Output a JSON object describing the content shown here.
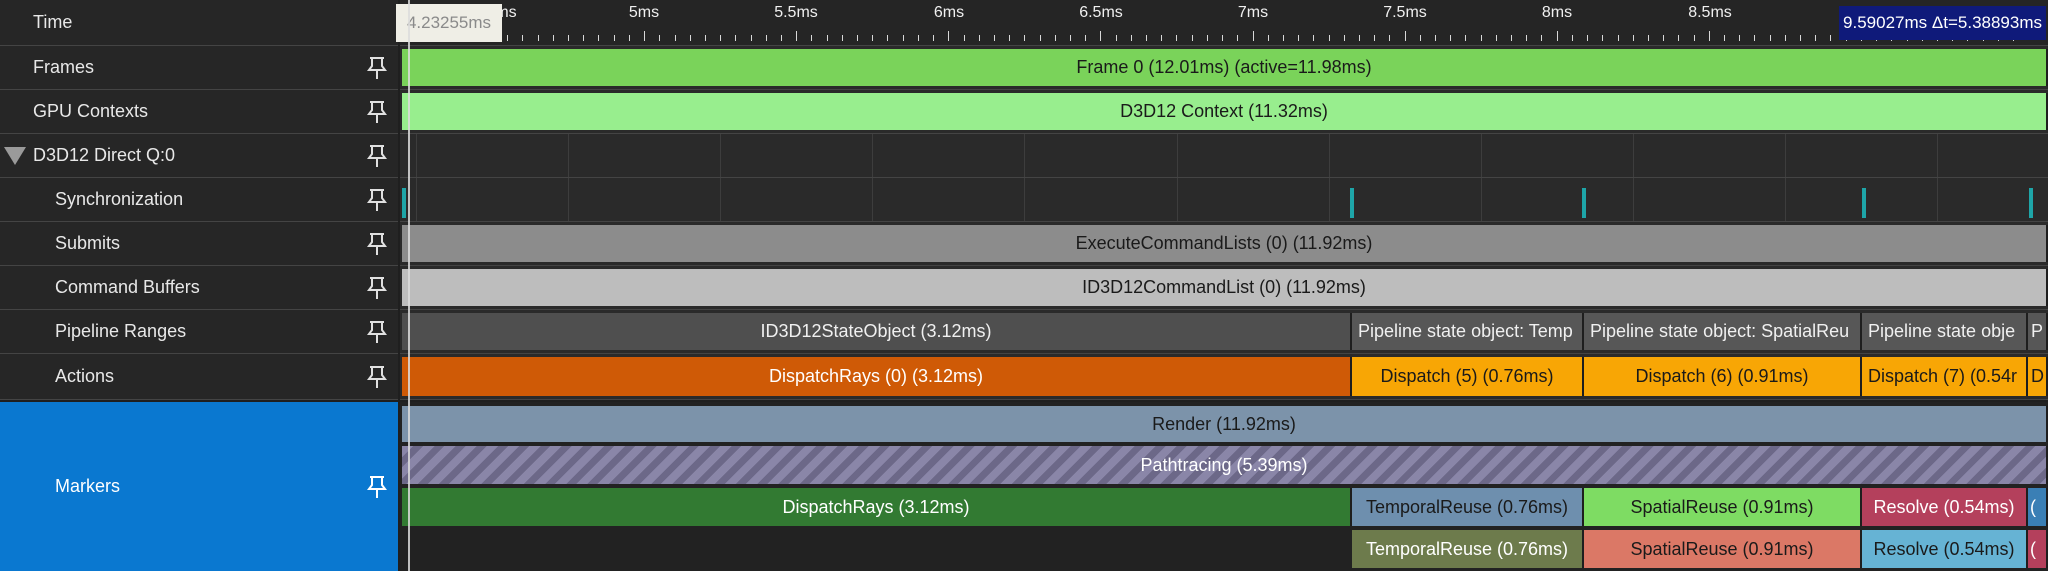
{
  "cursor_time": "4.23255ms",
  "selection_readout": "9.59027ms Δt=5.38893ms",
  "timeline": {
    "title": "Time",
    "ticks": [
      "5ms",
      "5.5ms",
      "6ms",
      "6.5ms",
      "7ms",
      "7.5ms",
      "8ms",
      "8.5ms"
    ],
    "partial_tick": "ms"
  },
  "rows": {
    "frames": {
      "label": "Frames",
      "bar": "Frame 0 (12.01ms) (active=11.98ms)"
    },
    "gpu_contexts": {
      "label": "GPU Contexts",
      "bar": "D3D12 Context (11.32ms)"
    },
    "direct_queue": {
      "label": "D3D12 Direct Q:0"
    },
    "synchronization": {
      "label": "Synchronization"
    },
    "submits": {
      "label": "Submits",
      "bar": "ExecuteCommandLists (0) (11.92ms)"
    },
    "command_buffers": {
      "label": "Command Buffers",
      "bar": "ID3D12CommandList (0) (11.92ms)"
    },
    "pipeline_ranges": {
      "label": "Pipeline Ranges",
      "bars": [
        "ID3D12StateObject (3.12ms)",
        "Pipeline state object: Temp",
        "Pipeline state object: SpatialReu",
        "Pipeline state obje",
        "P"
      ]
    },
    "actions": {
      "label": "Actions",
      "bars": [
        "DispatchRays (0) (3.12ms)",
        "Dispatch (5) (0.76ms)",
        "Dispatch (6) (0.91ms)",
        "Dispatch (7) (0.54r",
        "D"
      ]
    },
    "markers": {
      "label": "Markers",
      "render": "Render (11.92ms)",
      "pathtracing": "Pathtracing (5.39ms)",
      "level3": [
        "DispatchRays (3.12ms)",
        "TemporalReuse (0.76ms)",
        "SpatialReuse (0.91ms)",
        "Resolve (0.54ms)",
        "("
      ],
      "level4": [
        "TemporalReuse (0.76ms)",
        "SpatialReuse (0.91ms)",
        "Resolve (0.54ms)",
        "("
      ]
    }
  },
  "colors": {
    "frame": "#7ad35a",
    "context": "#98ee8e",
    "submits": "#8c8c8c",
    "cmdlist": "#bdbdbd",
    "stateobj": "#505050",
    "pso": "#555555",
    "dispatchrays": "#cf5a06",
    "dispatch": "#f8a605",
    "render": "#7c93aa",
    "markers_selected": "#0a78d0",
    "marker_dispatchrays": "#327a32",
    "temporal_a": "#6e8fae",
    "spatial_a": "#7edc63",
    "resolve_a": "#b4405c",
    "temporal_b": "#6d7b4c",
    "spatial_b": "#db7866",
    "resolve_b": "#66b3d4",
    "sync": "#1ea5a8",
    "readout_bg": "#0f1a7a"
  }
}
